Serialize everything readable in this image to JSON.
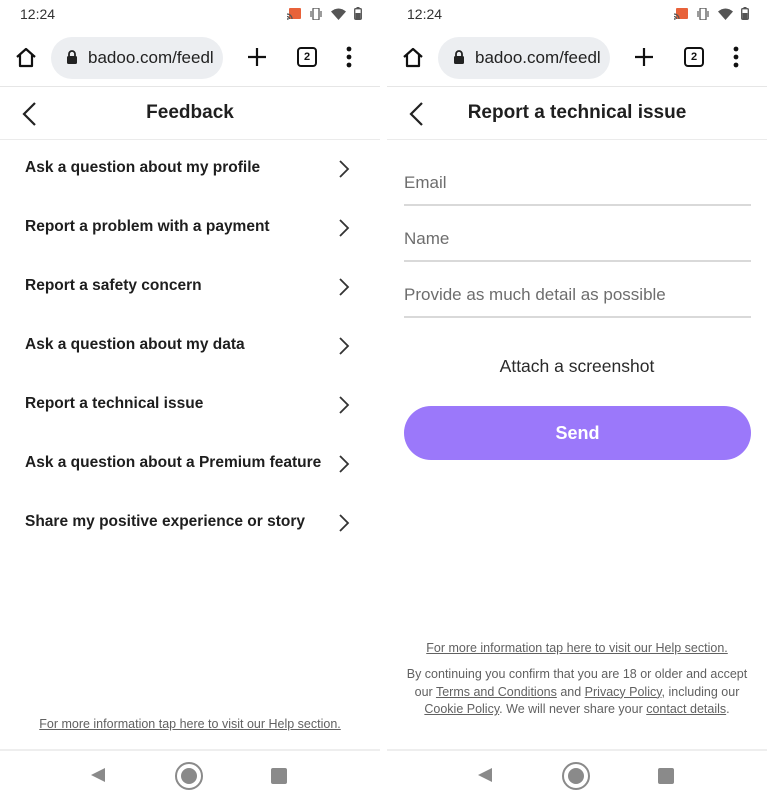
{
  "status_bar": {
    "time": "12:24",
    "icons": [
      "cast-icon",
      "vibrate-icon",
      "wifi-icon",
      "battery-icon"
    ]
  },
  "browser": {
    "url": "badoo.com/feedl",
    "tab_count": "2",
    "icons": [
      "home-icon",
      "lock-icon",
      "plus-icon",
      "tabs-icon",
      "more-vert-icon"
    ]
  },
  "feedback_screen": {
    "title": "Feedback",
    "items": [
      {
        "label": "Ask a question about my profile"
      },
      {
        "label": "Report a problem with a payment"
      },
      {
        "label": "Report a safety concern"
      },
      {
        "label": "Ask a question about my data"
      },
      {
        "label": "Report a technical issue"
      },
      {
        "label": "Ask a question about a Premium feature"
      },
      {
        "label": "Share my positive experience or story"
      }
    ],
    "help_link": "For more information tap here to visit our Help section."
  },
  "report_screen": {
    "title": "Report a technical issue",
    "email_placeholder": "Email",
    "email_value": "",
    "name_placeholder": "Name",
    "name_value": "",
    "detail_placeholder": "Provide as much detail as possible",
    "detail_value": "",
    "attach_label": "Attach a screenshot",
    "send_label": "Send",
    "send_color": "#9b78fa",
    "help_link": "For more information tap here to visit our Help section.",
    "legal": {
      "part1": "By continuing you confirm that you are 18 or older and accept our ",
      "terms_link": "Terms and Conditions",
      "part2": " and ",
      "privacy_link": "Privacy Policy",
      "part3": ", including our ",
      "cookie_link": "Cookie Policy",
      "part4": ". We will never share your ",
      "contact_link": "contact details",
      "part5": "."
    }
  },
  "nav_bar": {
    "icons": [
      "nav-back-icon",
      "nav-home-icon",
      "nav-recents-icon"
    ]
  }
}
